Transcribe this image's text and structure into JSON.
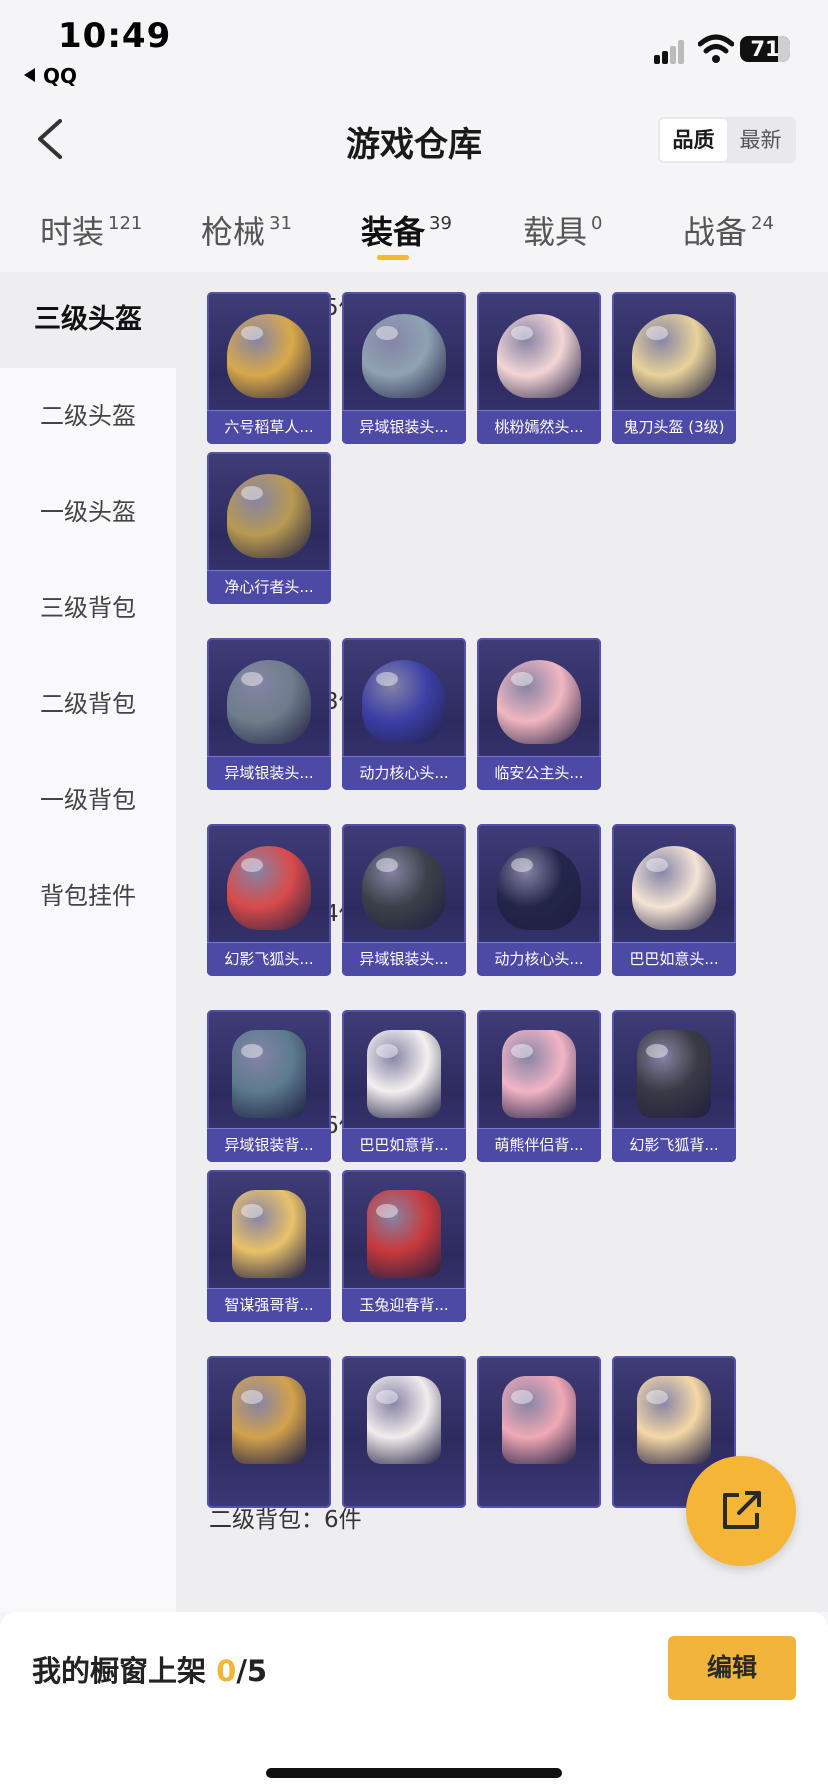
{
  "status": {
    "time": "10:49",
    "back_app": "QQ",
    "battery": "71"
  },
  "header": {
    "title": "游戏仓库",
    "sort": [
      "品质",
      "最新"
    ]
  },
  "tabs": [
    {
      "label": "时装",
      "count": "121"
    },
    {
      "label": "枪械",
      "count": "31"
    },
    {
      "label": "装备",
      "count": "39"
    },
    {
      "label": "载具",
      "count": "0"
    },
    {
      "label": "战备",
      "count": "24"
    }
  ],
  "sidebar": [
    "三级头盔",
    "二级头盔",
    "一级头盔",
    "三级背包",
    "二级背包",
    "一级背包",
    "背包挂件"
  ],
  "sections": [
    {
      "title": "三级头盔：5件",
      "items": [
        "六号稻草人...",
        "异域银装头...",
        "桃粉嫣然头...",
        "鬼刀头盔 (3级)",
        "净心行者头..."
      ]
    },
    {
      "title": "二级头盔：3件",
      "items": [
        "异域银装头...",
        "动力核心头...",
        "临安公主头..."
      ]
    },
    {
      "title": "一级头盔：4件",
      "items": [
        "幻影飞狐头...",
        "异域银装头...",
        "动力核心头...",
        "巴巴如意头..."
      ]
    },
    {
      "title": "三级背包：6件",
      "items": [
        "异域银装背...",
        "巴巴如意背...",
        "萌熊伴侣背...",
        "幻影飞狐背...",
        "智谋强哥背...",
        "玉兔迎春背..."
      ]
    },
    {
      "title": "二级背包：6件",
      "items": [
        "",
        "",
        "",
        ""
      ]
    }
  ],
  "item_colors": {
    "helmet3": [
      "#d9a94a",
      "#8fa2b3",
      "#f3d6d6",
      "#e8d39a",
      "#b89a52"
    ],
    "helmet2": [
      "#6f7d8c",
      "#3d3fa6",
      "#f0b7c0"
    ],
    "helmet1": [
      "#d94b4b",
      "#3b4148",
      "#23254a",
      "#f4e4d6"
    ],
    "pack3": [
      "#5d7b8e",
      "#f4f0f0",
      "#f2b5c6",
      "#3a3b44",
      "#e9c26a",
      "#c8393c"
    ],
    "pack2": [
      "#d3a24d",
      "#f2ecec",
      "#f0a9b6",
      "#f4d8a6"
    ]
  },
  "bottom": {
    "label": "我的橱窗上架",
    "count": "0",
    "total": "/5",
    "edit": "编辑"
  }
}
